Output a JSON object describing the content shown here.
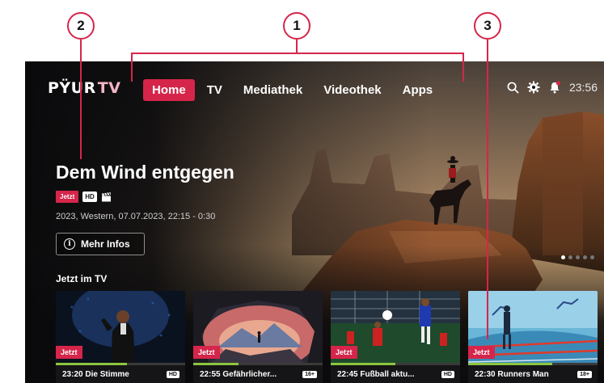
{
  "callouts": [
    "1",
    "2",
    "3"
  ],
  "header": {
    "logo_primary": "PŸUR",
    "logo_secondary": "TV",
    "nav": [
      {
        "label": "Home",
        "active": true
      },
      {
        "label": "TV",
        "active": false
      },
      {
        "label": "Mediathek",
        "active": false
      },
      {
        "label": "Videothek",
        "active": false
      },
      {
        "label": "Apps",
        "active": false
      }
    ],
    "icons": [
      "search-icon",
      "gear-icon",
      "notification-bell-icon"
    ],
    "clock": "23:56"
  },
  "hero": {
    "title": "Dem Wind entgegen",
    "badge_now": "Jetzt",
    "badge_quality": "HD",
    "media_icon": "clapperboard-icon",
    "meta": "2023,  Western, 07.07.2023, 22:15 - 0:30",
    "info_button": "Mehr Infos",
    "slide_count": 5,
    "active_slide": 1
  },
  "section": {
    "title": "Jetzt im TV",
    "tiles": [
      {
        "badge": "Jetzt",
        "caption": "23:20 Die Stimme",
        "tag": "HD",
        "progress": 0.55
      },
      {
        "badge": "Jetzt",
        "caption": "22:55 Gefährlicher...",
        "tag": "16+",
        "progress": 0.35
      },
      {
        "badge": "Jetzt",
        "caption": "22:45 Fußball aktu...",
        "tag": "HD",
        "progress": 0.5
      },
      {
        "badge": "Jetzt",
        "caption": "22:30 Runners Man",
        "tag": "18+",
        "progress": 0.65
      }
    ]
  },
  "colors": {
    "accent": "#d6254a",
    "progress": "#8dc63f",
    "background": "#0b0b0d"
  }
}
